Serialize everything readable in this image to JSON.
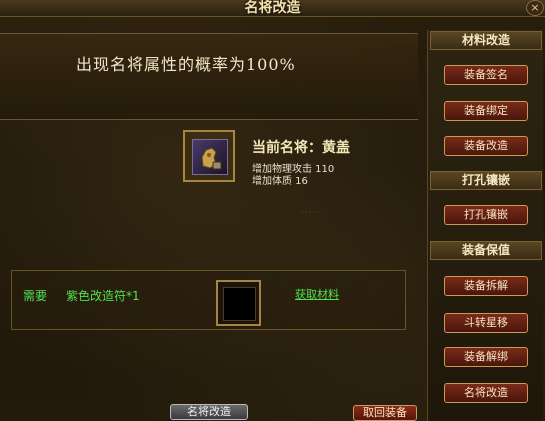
{
  "window": {
    "title": "名将改造",
    "close_glyph": "×"
  },
  "main": {
    "probability_text": "出现名将属性的概率为100%",
    "general_name": "当前名将：黄盖",
    "attributes": [
      "增加物理攻击 110",
      "增加体质 16"
    ],
    "requirement": {
      "label": "需要",
      "item": "紫色改造符*1",
      "link": "获取材料"
    }
  },
  "sidebar": {
    "sections": [
      {
        "header": "材料改造",
        "buttons": [
          "装备签名",
          "装备绑定",
          "装备改造"
        ]
      },
      {
        "header": "打孔镶嵌",
        "buttons": [
          "打孔镶嵌"
        ]
      },
      {
        "header": "装备保值",
        "buttons": [
          "装备拆解",
          "斗转星移",
          "装备解绑",
          "名将改造"
        ]
      }
    ]
  },
  "bottom": {
    "action_button": "名将改造",
    "back_button": "取回装备"
  },
  "colors": {
    "accent_green": "#4fe24f",
    "button_red": "#7a2a18",
    "border_gold": "#c99a55"
  }
}
